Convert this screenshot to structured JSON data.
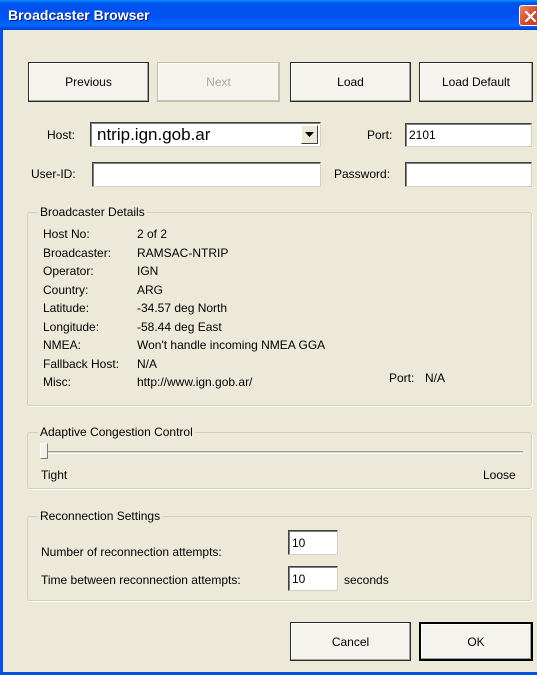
{
  "window": {
    "title": "Broadcaster Browser"
  },
  "toolbar": {
    "previous_label": "Previous",
    "next_label": "Next",
    "load_label": "Load",
    "load_default_label": "Load Default"
  },
  "connection": {
    "host_label": "Host:",
    "host_value": "ntrip.ign.gob.ar",
    "port_label": "Port:",
    "port_value": "2101",
    "userid_label": "User-ID:",
    "userid_value": "",
    "password_label": "Password:",
    "password_value": ""
  },
  "details": {
    "legend": "Broadcaster Details",
    "rows": [
      {
        "label": "Host No:",
        "value": "2 of 2"
      },
      {
        "label": "Broadcaster:",
        "value": "RAMSAC-NTRIP"
      },
      {
        "label": "Operator:",
        "value": "IGN"
      },
      {
        "label": "Country:",
        "value": "ARG"
      },
      {
        "label": "Latitude:",
        "value": "-34.57 deg North"
      },
      {
        "label": "Longitude:",
        "value": "-58.44 deg East"
      },
      {
        "label": "NMEA:",
        "value": "Won't handle incoming NMEA GGA"
      },
      {
        "label": "Fallback Host:",
        "value": "N/A"
      },
      {
        "label": "Misc:",
        "value": "http://www.ign.gob.ar/"
      }
    ],
    "fallback_port_label": "Port:",
    "fallback_port_value": "N/A"
  },
  "congestion": {
    "legend": "Adaptive Congestion Control",
    "min_label": "Tight",
    "max_label": "Loose",
    "level": 0
  },
  "reconnection": {
    "legend": "Reconnection Settings",
    "attempts_label": "Number of reconnection attempts:",
    "attempts_value": "10",
    "interval_label": "Time between reconnection attempts:",
    "interval_value": "10",
    "interval_unit": "seconds"
  },
  "footer": {
    "cancel_label": "Cancel",
    "ok_label": "OK"
  },
  "icons": {
    "close": "close-icon",
    "dropdown": "chevron-down-icon"
  },
  "colors": {
    "titlebar": "#0054e3",
    "window_bg": "#ece9d8",
    "close_button": "#d5472a"
  }
}
